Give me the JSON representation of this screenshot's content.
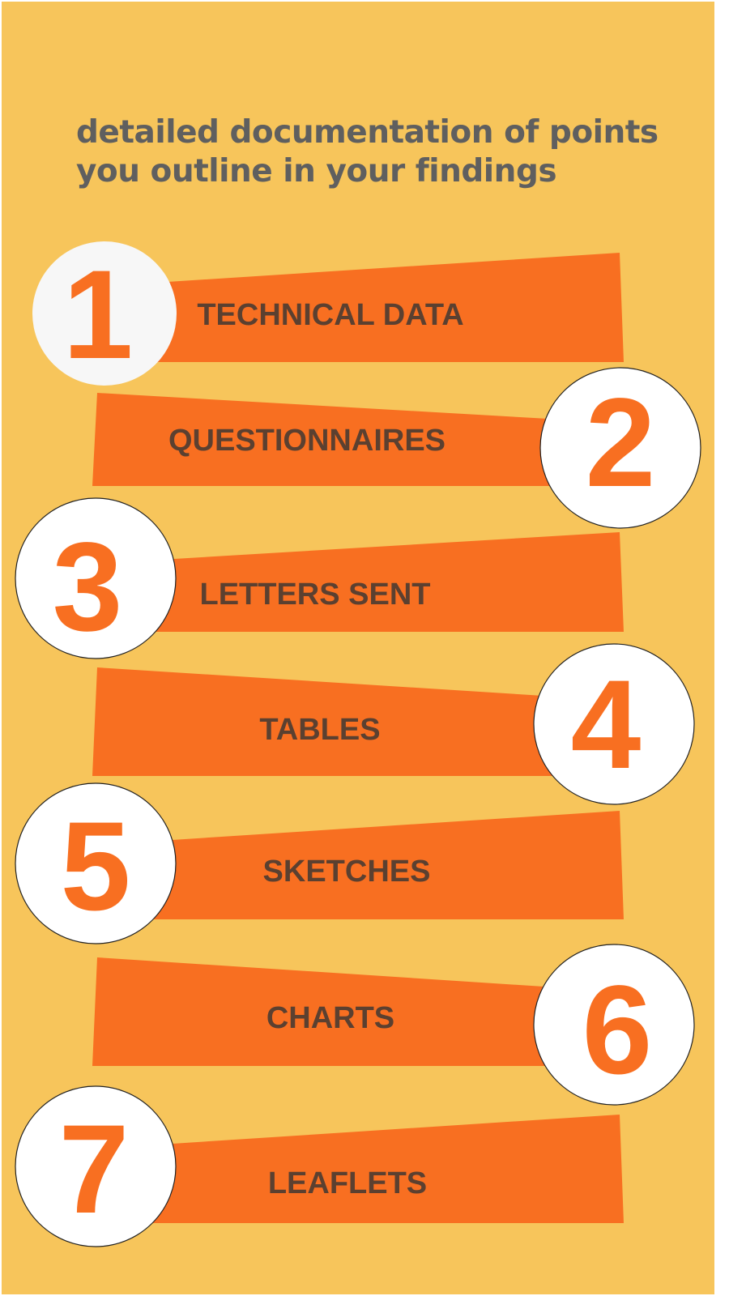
{
  "heading": {
    "line1": "detailed documentation of points",
    "line2": "you outline in your findings"
  },
  "colors": {
    "background": "#f7c55b",
    "ribbon": "#f86f21",
    "number": "#f86f21",
    "label_text": "#5b4030",
    "heading_text": "#5f5f5f",
    "circle": "#ffffff"
  },
  "steps": [
    {
      "number": "1",
      "label": "TECHNICAL DATA"
    },
    {
      "number": "2",
      "label": "QUESTIONNAIRES"
    },
    {
      "number": "3",
      "label": "LETTERS SENT"
    },
    {
      "number": "4",
      "label": "TABLES"
    },
    {
      "number": "5",
      "label": "SKETCHES"
    },
    {
      "number": "6",
      "label": "CHARTS"
    },
    {
      "number": "7",
      "label": "LEAFLETS"
    }
  ]
}
